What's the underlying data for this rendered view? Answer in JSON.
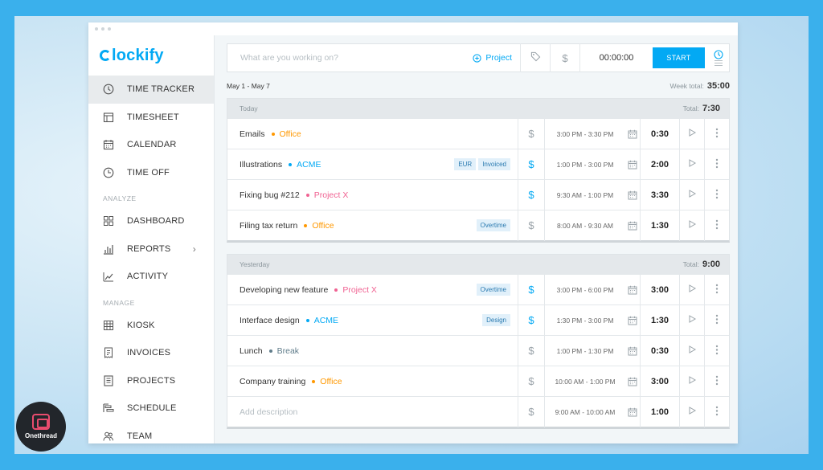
{
  "app": {
    "logo_text": "lockify",
    "brand_color": "#03a9f4"
  },
  "sidebar": {
    "items": [
      {
        "label": "TIME TRACKER",
        "icon": "clock-icon",
        "active": true
      },
      {
        "label": "TIMESHEET",
        "icon": "timesheet-icon"
      },
      {
        "label": "CALENDAR",
        "icon": "calendar-icon"
      },
      {
        "label": "TIME OFF",
        "icon": "time-off-icon"
      }
    ],
    "analyze_label": "ANALYZE",
    "analyze_items": [
      {
        "label": "DASHBOARD",
        "icon": "dashboard-icon"
      },
      {
        "label": "REPORTS",
        "icon": "reports-icon"
      },
      {
        "label": "ACTIVITY",
        "icon": "activity-icon"
      }
    ],
    "manage_label": "MANAGE",
    "manage_items": [
      {
        "label": "KIOSK",
        "icon": "kiosk-icon"
      },
      {
        "label": "INVOICES",
        "icon": "invoices-icon"
      },
      {
        "label": "PROJECTS",
        "icon": "projects-icon"
      },
      {
        "label": "SCHEDULE",
        "icon": "schedule-icon"
      },
      {
        "label": "TEAM",
        "icon": "team-icon"
      }
    ]
  },
  "tracker": {
    "placeholder": "What are you working on?",
    "project_label": "Project",
    "timer": "00:00:00",
    "start_label": "START"
  },
  "week": {
    "range": "May 1 - May 7",
    "total_label": "Week total:",
    "total": "35:00"
  },
  "days": [
    {
      "label": "Today",
      "total_label": "Total:",
      "total": "7:30",
      "entries": [
        {
          "description": "Emails",
          "project": "Office",
          "project_color": "#ff9800",
          "badges": [],
          "billable": false,
          "range": "3:00 PM - 3:30 PM",
          "duration": "0:30"
        },
        {
          "description": "Illustrations",
          "project": "ACME",
          "project_color": "#03a9f4",
          "badges": [
            "EUR",
            "Invoiced"
          ],
          "billable": true,
          "range": "1:00 PM - 3:00 PM",
          "duration": "2:00"
        },
        {
          "description": "Fixing bug #212",
          "project": "Project X",
          "project_color": "#f06292",
          "badges": [],
          "billable": true,
          "range": "9:30 AM - 1:00 PM",
          "duration": "3:30"
        },
        {
          "description": "Filing tax return",
          "project": "Office",
          "project_color": "#ff9800",
          "badges": [
            "Overtime"
          ],
          "billable": false,
          "range": "8:00 AM - 9:30 AM",
          "duration": "1:30"
        }
      ]
    },
    {
      "label": "Yesterday",
      "total_label": "Total:",
      "total": "9:00",
      "entries": [
        {
          "description": "Developing new feature",
          "project": "Project X",
          "project_color": "#f06292",
          "badges": [
            "Overtime"
          ],
          "billable": true,
          "range": "3:00 PM - 6:00 PM",
          "duration": "3:00"
        },
        {
          "description": "Interface design",
          "project": "ACME",
          "project_color": "#03a9f4",
          "badges": [
            "Design"
          ],
          "billable": true,
          "range": "1:30 PM - 3:00 PM",
          "duration": "1:30"
        },
        {
          "description": "Lunch",
          "project": "Break",
          "project_color": "#607d8b",
          "badges": [],
          "billable": false,
          "range": "1:00 PM - 1:30 PM",
          "duration": "0:30"
        },
        {
          "description": "Company training",
          "project": "Office",
          "project_color": "#ff9800",
          "badges": [],
          "billable": false,
          "range": "10:00 AM - 1:00 PM",
          "duration": "3:00"
        },
        {
          "description": "Add description",
          "project": "",
          "project_color": "",
          "badges": [],
          "billable": false,
          "range": "9:00 AM - 10:00 AM",
          "duration": "1:00",
          "placeholder": true
        }
      ]
    }
  ],
  "watermark": {
    "text": "Onethread"
  }
}
